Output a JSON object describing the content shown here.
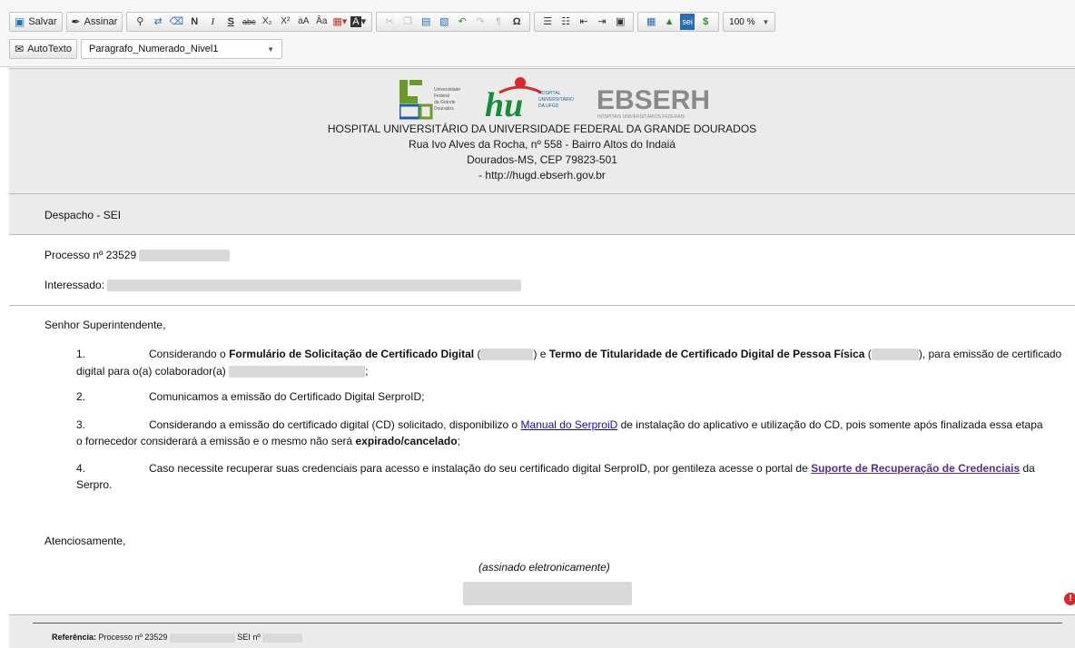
{
  "toolbar": {
    "save_label": "Salvar",
    "sign_label": "Assinar",
    "autotext_label": "AutoTexto",
    "style_select_value": "Paragrafo_Numerado_Nivel1",
    "zoom_value": "100 %",
    "format_icons": [
      "search-icon",
      "replace-icon",
      "eraser-icon",
      "bold-icon",
      "italic-icon",
      "underline-icon",
      "strike-icon",
      "subscript-icon",
      "superscript-icon",
      "uppercase-icon",
      "lowercase-icon",
      "text-color-icon",
      "bg-color-icon"
    ],
    "bold_glyph": "N",
    "italic_glyph": "I",
    "underline_glyph": "S",
    "strike_glyph": "abc",
    "sub_glyph": "X₂",
    "sup_glyph": "X²",
    "upper_glyph": "ẚA",
    "lower_glyph": "Âa",
    "pilcrow_glyph": "¶",
    "omega_glyph": "Ω",
    "dollar_glyph": "$",
    "sei_glyph": "sei"
  },
  "header": {
    "logo_ufgd_lines": [
      "Universidade",
      "Federal",
      "da Grande",
      "Dourados"
    ],
    "logo_hu_text": "hu",
    "logo_hu_lines": [
      "HOSPITAL",
      "UNIVERSITÁRIO",
      "DA UFGD"
    ],
    "logo_ebserh": "EBSERH",
    "logo_ebserh_sub": "HOSPITAIS UNIVERSITÁRIOS FEDERAIS",
    "institution": "HOSPITAL UNIVERSITÁRIO DA UNIVERSIDADE FEDERAL DA GRANDE DOURADOS",
    "address": "Rua Ivo Alves da Rocha, nº 558 - Bairro Altos do Indaiá",
    "city": "Dourados-MS, CEP 79823-501",
    "site": "- http://hugd.ebserh.gov.br"
  },
  "doc_type": "Despacho - SEI",
  "process_label": "Processo nº 23529",
  "interested_label": "Interessado:",
  "salutation": "Senhor Superintendente,",
  "items": [
    {
      "num": "1.",
      "p1": "Considerando o ",
      "b1": "Formulário de Solicitação de Certificado Digital",
      "p2": " (",
      "p3": ") e ",
      "b2": "Termo de Titularidade de Certificado Digital de Pessoa Física",
      "p4": " (",
      "p5": "), para emissão de certificado",
      "line2a": "digital para o(a) colaborador(a) ",
      "line2b": ";"
    },
    {
      "num": "2.",
      "text": "Comunicamos a emissão do Certificado Digital SerproID;"
    },
    {
      "num": "3.",
      "p1": "Considerando a emissão do certificado digital (CD) solicitado, disponibilizo o ",
      "link": "Manual do SerproiD",
      "p2": " de instalação do aplicativo e utilização do CD, pois somente após finalizada essa etapa",
      "line2a": "o fornecedor considerará a emissão e o mesmo não será ",
      "line2b": "expirado/cancelado",
      "line2c": ";"
    },
    {
      "num": "4.",
      "p1": "Caso necessite recuperar suas credenciais para acesso e instalação do seu certificado digital SerproID, por gentileza acesse o portal de ",
      "link": "Suporte de Recuperação de Credenciais",
      "p2": " da",
      "line2": "Serpro."
    }
  ],
  "closing": "Atenciosamente,",
  "signed": "(assinado eletronicamente)",
  "footer": {
    "ref_label": "Referência:",
    "ref_text": "Processo nº 23529",
    "sei_label": "SEI nº"
  },
  "alert_badge": "!"
}
